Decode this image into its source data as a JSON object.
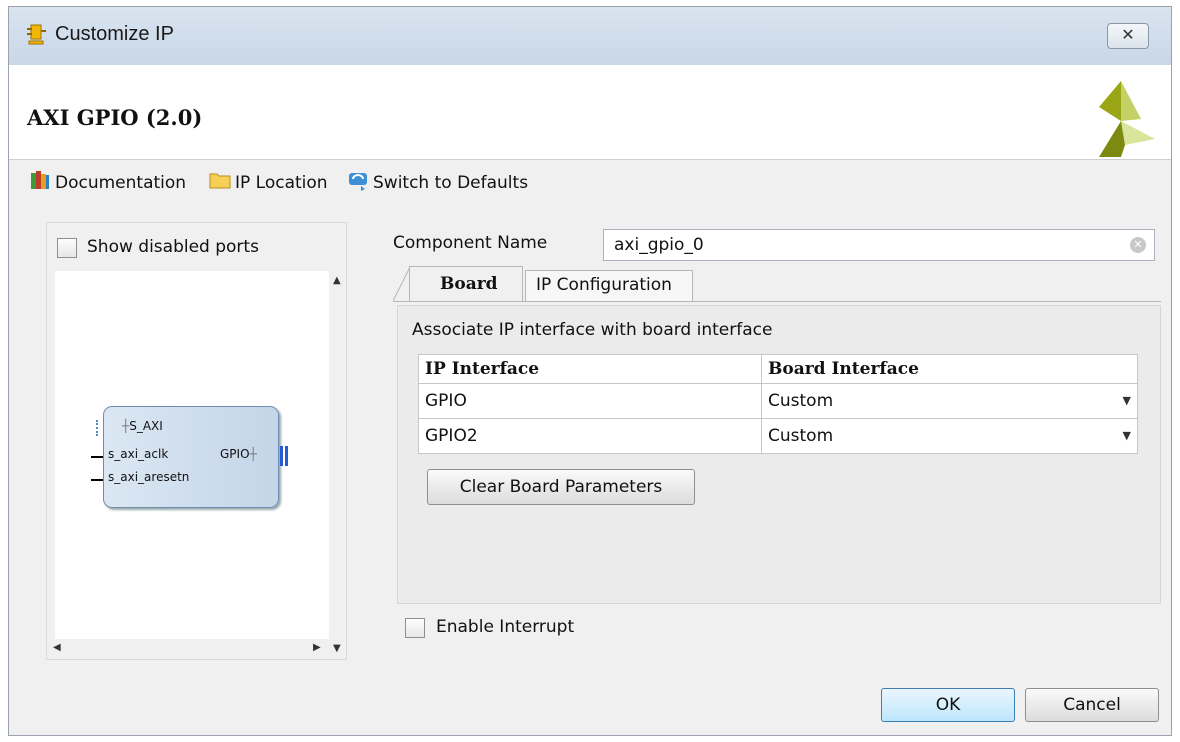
{
  "window": {
    "title": "Customize IP",
    "close_glyph": "✕"
  },
  "banner": {
    "title": "AXI GPIO (2.0)"
  },
  "toolbar": {
    "documentation": "Documentation",
    "ip_location": "IP Location",
    "switch_defaults": "Switch to Defaults"
  },
  "left": {
    "show_disabled_ports": "Show disabled ports",
    "show_disabled_checked": false,
    "block": {
      "s_axi": "S_AXI",
      "s_axi_aclk": "s_axi_aclk",
      "s_axi_aresetn": "s_axi_aresetn",
      "gpio": "GPIO"
    }
  },
  "component": {
    "label": "Component Name",
    "value": "axi_gpio_0"
  },
  "tabs": [
    {
      "label": "Board",
      "active": true
    },
    {
      "label": "IP Configuration",
      "active": false
    }
  ],
  "board": {
    "heading": "Associate IP interface with board interface",
    "columns": [
      "IP Interface",
      "Board Interface"
    ],
    "rows": [
      {
        "ip": "GPIO",
        "board": "Custom"
      },
      {
        "ip": "GPIO2",
        "board": "Custom"
      }
    ],
    "clear_button": "Clear Board Parameters"
  },
  "enable_interrupt": {
    "label": "Enable Interrupt",
    "checked": false
  },
  "footer": {
    "ok": "OK",
    "cancel": "Cancel"
  },
  "icons": {
    "title": "ip-customize-icon",
    "close": "close-icon",
    "documentation": "books-icon",
    "ip_location": "folder-icon",
    "switch_defaults": "refresh-icon",
    "logo": "xilinx-logo-icon",
    "clear_input": "clear-input-icon"
  }
}
